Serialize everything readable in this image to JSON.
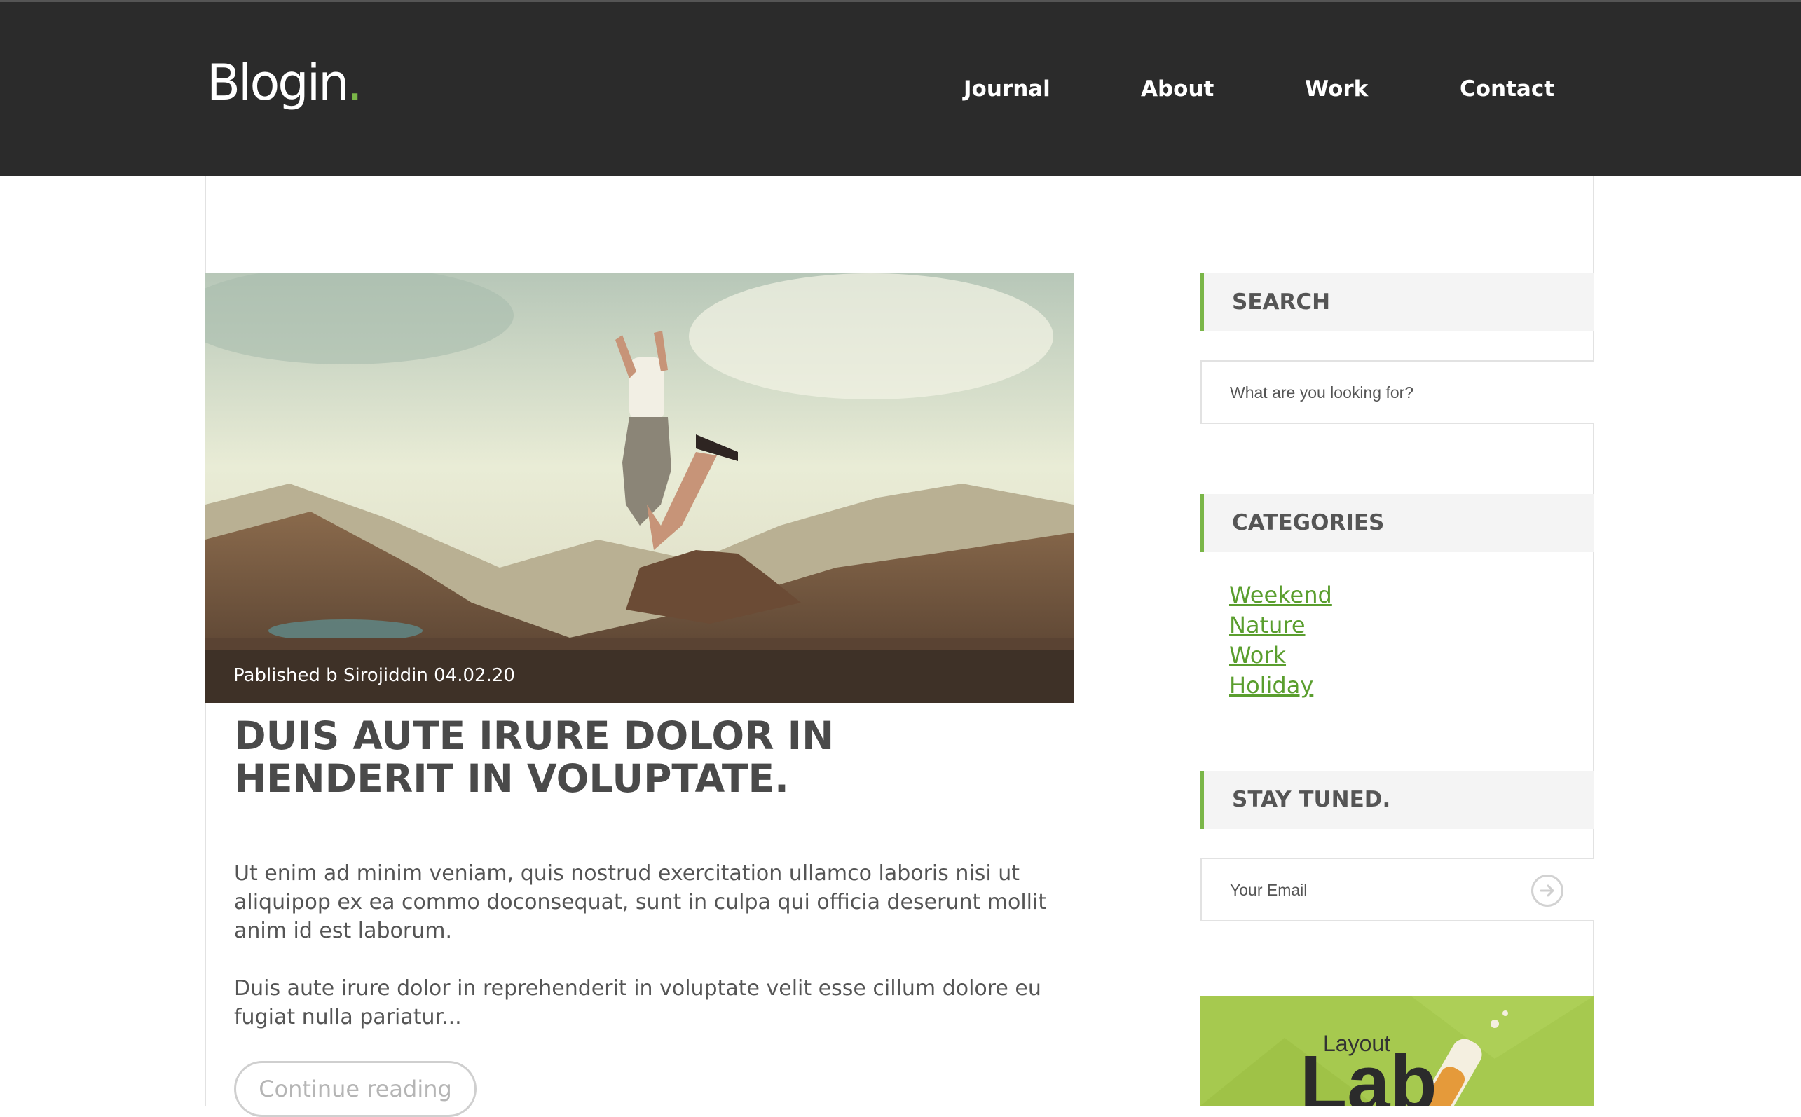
{
  "brand": {
    "logo_text": "Blogin",
    "logo_dot": ".",
    "accent_color": "#7ab648"
  },
  "nav": {
    "items": [
      "Journal",
      "About",
      "Work",
      "Contact"
    ]
  },
  "post": {
    "caption": "Pablished b Sirojiddin 04.02.20",
    "title": "DUIS AUTE IRURE DOLOR IN HENDERIT IN VOLUPTATE.",
    "paragraphs": [
      "Ut enim ad minim veniam, quis nostrud exercitation ullamco laboris nisi ut aliquipop ex ea commo doconsequat, sunt in culpa qui officia deserunt mollit anim id est laborum.",
      "Duis aute irure dolor in reprehenderit in voluptate velit esse cillum dolore eu fugiat nulla pariatur..."
    ],
    "continue_label": "Continue reading"
  },
  "sidebar": {
    "search": {
      "title": "SEARCH",
      "placeholder": "What are you looking for?"
    },
    "categories": {
      "title": "CATEGORIES",
      "items": [
        "Weekend",
        "Nature",
        "Work",
        "Holiday"
      ]
    },
    "newsletter": {
      "title": "STAY TUNED.",
      "placeholder": "Your Email",
      "submit_icon": "arrow-right-circle-icon"
    },
    "ad": {
      "small_text": "Layout",
      "big_text": "Lab"
    }
  }
}
